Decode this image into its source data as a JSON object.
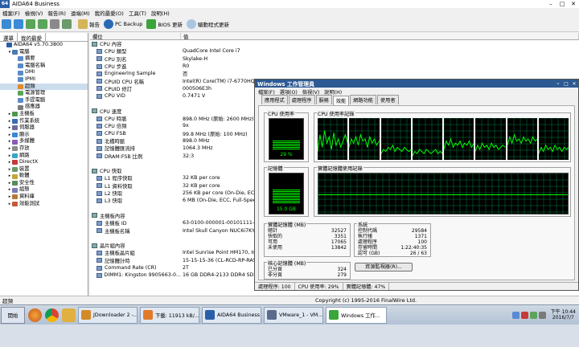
{
  "app": {
    "logo": "64",
    "title": "AIDA64 Business"
  },
  "menu": [
    "檔案(F)",
    "檢視(V)",
    "報告(R)",
    "遠端(M)",
    "我的最愛(O)",
    "工具(T)",
    "說明(H)"
  ],
  "toolbar": {
    "report": "報告",
    "pcbackup": "PC Backup",
    "bios": "BIOS 更新",
    "driver": "驅動程式更新"
  },
  "leftpane": {
    "tabs": [
      "選單",
      "我的最愛"
    ],
    "tree": [
      {
        "label": "AIDA64 v5.70.3800",
        "indent": 0,
        "icon": "#2a5ea8",
        "tw": ""
      },
      {
        "label": "電腦",
        "indent": 1,
        "icon": "#4a7ab5",
        "tw": "▾"
      },
      {
        "label": "摘要",
        "indent": 2,
        "icon": "#5a8ac8",
        "tw": ""
      },
      {
        "label": "電腦名稱",
        "indent": 2,
        "icon": "#5a8ac8",
        "tw": ""
      },
      {
        "label": "DMI",
        "indent": 2,
        "icon": "#5a8ac8",
        "tw": ""
      },
      {
        "label": "IPMI",
        "indent": 2,
        "icon": "#5a8ac8",
        "tw": ""
      },
      {
        "label": "超頻",
        "indent": 2,
        "icon": "#e08a2a",
        "tw": ""
      },
      {
        "label": "電源管理",
        "indent": 2,
        "icon": "#5aa55a",
        "tw": ""
      },
      {
        "label": "手提電腦",
        "indent": 2,
        "icon": "#5a8ac8",
        "tw": ""
      },
      {
        "label": "感應器",
        "indent": 2,
        "icon": "#7a7a7a",
        "tw": ""
      },
      {
        "label": "主機板",
        "indent": 1,
        "icon": "#4a9a4a",
        "tw": "▸"
      },
      {
        "label": "作業系統",
        "indent": 1,
        "icon": "#3a6ab5",
        "tw": "▸"
      },
      {
        "label": "伺服器",
        "indent": 1,
        "icon": "#6a6a9a",
        "tw": "▸"
      },
      {
        "label": "顯示",
        "indent": 1,
        "icon": "#3a8ad5",
        "tw": "▸"
      },
      {
        "label": "多媒體",
        "indent": 1,
        "icon": "#8a5ab5",
        "tw": "▸"
      },
      {
        "label": "存放",
        "indent": 1,
        "icon": "#8a8a8a",
        "tw": "▸"
      },
      {
        "label": "網路",
        "indent": 1,
        "icon": "#3aa5c5",
        "tw": "▸"
      },
      {
        "label": "DirectX",
        "indent": 1,
        "icon": "#c53a3a",
        "tw": "▸"
      },
      {
        "label": "裝置",
        "indent": 1,
        "icon": "#6a9a6a",
        "tw": "▸"
      },
      {
        "label": "軟體",
        "indent": 1,
        "icon": "#c5a53a",
        "tw": "▸"
      },
      {
        "label": "安全性",
        "indent": 1,
        "icon": "#5a8a5a",
        "tw": "▸"
      },
      {
        "label": "組態",
        "indent": 1,
        "icon": "#7a7ab5",
        "tw": "▸"
      },
      {
        "label": "資料庫",
        "indent": 1,
        "icon": "#b57a3a",
        "tw": "▸"
      },
      {
        "label": "效能測試",
        "indent": 1,
        "icon": "#c55a3a",
        "tw": "▸"
      }
    ]
  },
  "columns": {
    "field": "欄位",
    "value": "值"
  },
  "rows": [
    {
      "f": "CPU 內容",
      "v": "",
      "sec": true
    },
    {
      "f": "CPU 類型",
      "v": "QuadCore Intel Core i7"
    },
    {
      "f": "CPU 別名",
      "v": "Skylake-H"
    },
    {
      "f": "CPU 步進",
      "v": "R0"
    },
    {
      "f": "Engineering Sample",
      "v": "否"
    },
    {
      "f": "CPUID CPU 名稱",
      "v": "Intel(R) Core(TM) i7-6770HQ C"
    },
    {
      "f": "CPUID 修訂",
      "v": "000506E3h"
    },
    {
      "f": "CPU VID",
      "v": "0.7471 V"
    },
    {
      "f": "",
      "v": "",
      "blank": true
    },
    {
      "f": "CPU 速度",
      "v": "",
      "sec": true
    },
    {
      "f": "CPU 時脈",
      "v": "898.0 MHz  (原始: 2600 MHz)"
    },
    {
      "f": "CPU 倍頻",
      "v": "9x"
    },
    {
      "f": "CPU FSB",
      "v": "99.8 MHz  (原始: 100 MHz)"
    },
    {
      "f": "北橋時脈",
      "v": "898.0 MHz"
    },
    {
      "f": "記憶體匯流排",
      "v": "1064.3 MHz"
    },
    {
      "f": "DRAM:FSB 比例",
      "v": "32:3"
    },
    {
      "f": "",
      "v": "",
      "blank": true
    },
    {
      "f": "CPU 快取",
      "v": "",
      "sec": true
    },
    {
      "f": "L1 程序快取",
      "v": "32 KB per core"
    },
    {
      "f": "L1 資料快取",
      "v": "32 KB per core"
    },
    {
      "f": "L2 快取",
      "v": "256 KB per core  (On-Die, ECC,"
    },
    {
      "f": "L3 快取",
      "v": "6 MB  (On-Die, ECC, Full-Spee"
    },
    {
      "f": "",
      "v": "",
      "blank": true
    },
    {
      "f": "主機板內容",
      "v": "",
      "sec": true
    },
    {
      "f": "主機板 ID",
      "v": "63-0100-000001-00101111-051"
    },
    {
      "f": "主機板名稱",
      "v": "Intel Skull Canyon NUC6i7KYH"
    },
    {
      "f": "",
      "v": "",
      "blank": true
    },
    {
      "f": "晶片組內容",
      "v": "",
      "sec": true
    },
    {
      "f": "主機板晶片組",
      "v": "Intel Sunrise Point HM170, Inte"
    },
    {
      "f": "記憶體計時",
      "v": "15-15-15-36  (CL-RCD-RP-RAS)"
    },
    {
      "f": "Command Rate (CR)",
      "v": "2T"
    },
    {
      "f": "DIMM1: Kingston 9905663-0...",
      "v": "16 GB DDR4-2133 DDR4 SDRAM  (16-15-15-36 @ 1066 MHz)  (15-15-15..."
    }
  ],
  "status": {
    "left": "超頻",
    "copyright": "Copyright (c) 1995-2016 FinalWire Ltd."
  },
  "taskmgr": {
    "title": "Windows 工作管理員",
    "menu": [
      "檔案(F)",
      "選項(O)",
      "檢視(V)",
      "說明(H)"
    ],
    "tabs": [
      "應用程式",
      "處理程序",
      "服務",
      "效能",
      "網路功能",
      "使用者"
    ],
    "cpu_usage_label": "CPU 使用率",
    "cpu_usage_value": "29 %",
    "cpu_history_label": "CPU 使用率記錄",
    "mem_label": "記憶體",
    "mem_value": "15.0 GB",
    "mem_history_label": "實體記憶體使用記錄",
    "phys": {
      "label": "實體記憶體 (MB)",
      "rows": [
        [
          "總計",
          "32527"
        ],
        [
          "快取的",
          "3351"
        ],
        [
          "可用",
          "17065"
        ],
        [
          "未使用",
          "13842"
        ]
      ]
    },
    "system": {
      "label": "系統",
      "rows": [
        [
          "控制代碼",
          "29584"
        ],
        [
          "執行緒",
          "1371"
        ],
        [
          "處理程序",
          "100"
        ],
        [
          "存留時間",
          "1:22:40:35"
        ],
        [
          "認可 (GB)",
          "26 / 63"
        ]
      ]
    },
    "kernel": {
      "label": "核心記憶體 (MB)",
      "rows": [
        [
          "已分頁",
          "324"
        ],
        [
          "非分頁",
          "279"
        ]
      ]
    },
    "resource_button": "資源監視器(R)...",
    "statusbar": [
      "處理程序: 100",
      "CPU 使用率: 29%",
      "實體記憶體: 47%"
    ]
  },
  "chart_data": [
    {
      "type": "line",
      "title": "CPU 使用率記錄",
      "series": [
        {
          "values": [
            20,
            60,
            30,
            70,
            40,
            55,
            25,
            65,
            35,
            50,
            30,
            45,
            60,
            40
          ]
        },
        {
          "values": [
            30,
            50,
            40,
            55,
            35,
            60,
            45,
            50,
            30,
            55,
            40,
            50,
            35,
            45
          ]
        },
        {
          "values": [
            15,
            25,
            20,
            30,
            25,
            35,
            20,
            30,
            25,
            20,
            30,
            25,
            20,
            25
          ]
        },
        {
          "values": [
            10,
            20,
            15,
            25,
            20,
            15,
            25,
            20,
            15,
            20,
            25,
            15,
            20,
            15
          ]
        },
        {
          "values": [
            25,
            45,
            35,
            50,
            30,
            40,
            35,
            45,
            30,
            40,
            35,
            45,
            30,
            40
          ]
        },
        {
          "values": [
            20,
            35,
            25,
            40,
            30,
            35,
            25,
            40,
            30,
            35,
            25,
            30,
            35,
            30
          ]
        },
        {
          "values": [
            35,
            55,
            40,
            60,
            45,
            50,
            40,
            55,
            45,
            50,
            40,
            55,
            45,
            50
          ]
        },
        {
          "values": [
            15,
            30,
            20,
            35,
            25,
            30,
            20,
            35,
            25,
            30,
            20,
            30,
            25,
            30
          ]
        }
      ],
      "ylim": [
        0,
        100
      ]
    },
    {
      "type": "line",
      "title": "實體記憶體使用記錄",
      "series": [
        {
          "values": [
            47,
            47,
            47,
            47,
            47,
            47,
            47,
            47,
            47,
            47,
            47,
            47,
            47,
            47
          ]
        }
      ],
      "ylim": [
        0,
        100
      ]
    }
  ],
  "taskbar": {
    "start": "開始",
    "buttons": [
      {
        "label": "JDownloader 2 -...",
        "color": "#d58a2a"
      },
      {
        "label": "下載: 11913 kB/...",
        "color": "#e07a2a"
      },
      {
        "label": "AIDA64 Business",
        "color": "#2a5ea8"
      },
      {
        "label": "VMware_1 - VM...",
        "color": "#5a6a8a"
      },
      {
        "label": "Windows 工作...",
        "color": "#3aa53a",
        "active": true
      }
    ],
    "time": "下午 10:44",
    "date": "2016/7/7"
  },
  "colors": {
    "accent": "#2d5a92",
    "graph": "#00ff00",
    "graph_bg": "#000000",
    "grid": "#008040"
  }
}
